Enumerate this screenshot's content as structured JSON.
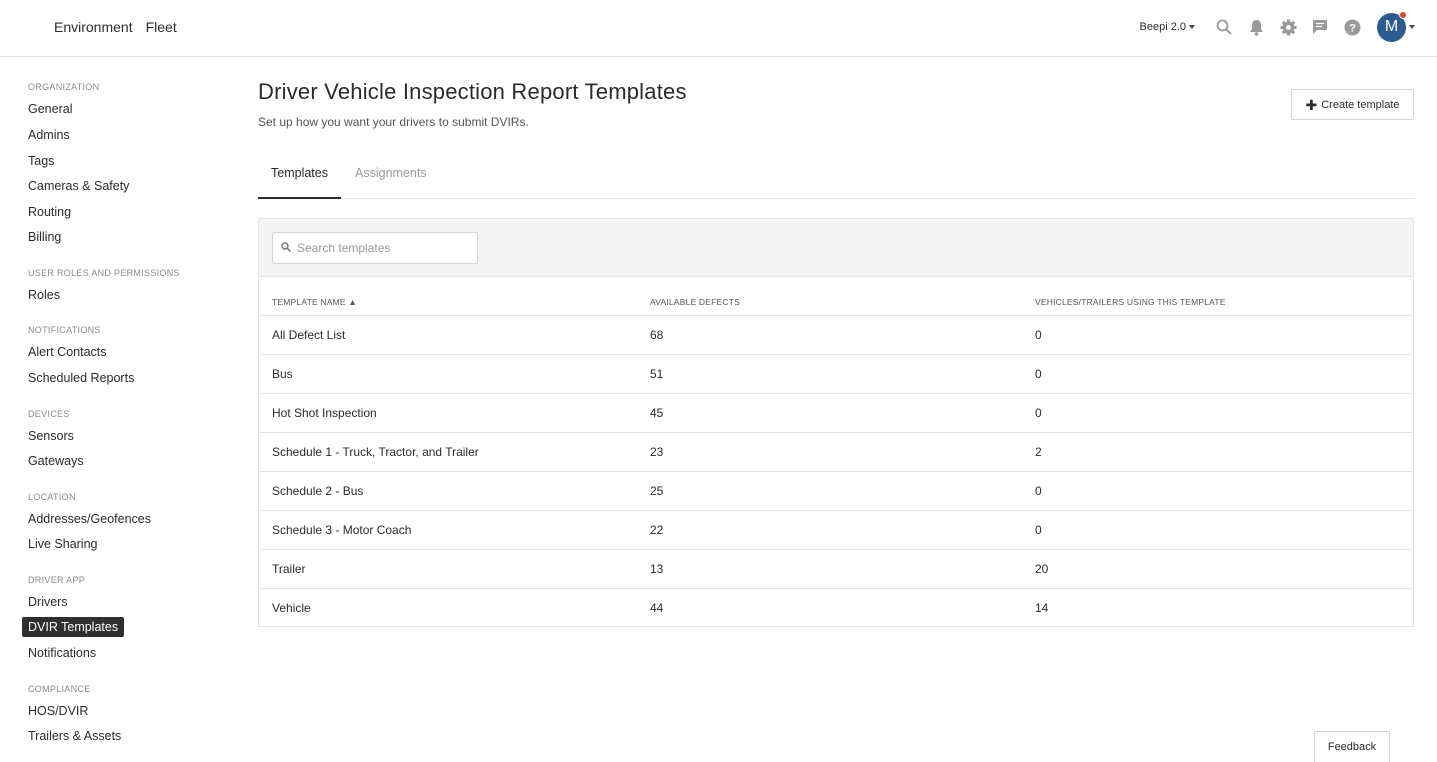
{
  "topnav": {
    "environment": "Environment",
    "fleet": "Fleet"
  },
  "header": {
    "org_name": "Beepi 2.0",
    "avatar_initial": "M"
  },
  "sidebar": {
    "sections": [
      {
        "title": "ORGANIZATION",
        "items": [
          "General",
          "Admins",
          "Tags",
          "Cameras & Safety",
          "Routing",
          "Billing"
        ]
      },
      {
        "title": "USER ROLES AND PERMISSIONS",
        "items": [
          "Roles"
        ]
      },
      {
        "title": "NOTIFICATIONS",
        "items": [
          "Alert Contacts",
          "Scheduled Reports"
        ]
      },
      {
        "title": "DEVICES",
        "items": [
          "Sensors",
          "Gateways"
        ]
      },
      {
        "title": "LOCATION",
        "items": [
          "Addresses/Geofences",
          "Live Sharing"
        ]
      },
      {
        "title": "DRIVER APP",
        "items": [
          "Drivers",
          "DVIR Templates",
          "Notifications"
        ]
      },
      {
        "title": "COMPLIANCE",
        "items": [
          "HOS/DVIR",
          "Trailers & Assets"
        ]
      }
    ]
  },
  "page": {
    "title": "Driver Vehicle Inspection Report Templates",
    "subtitle": "Set up how you want your drivers to submit DVIRs.",
    "create_label": "Create template"
  },
  "tabs": {
    "templates": "Templates",
    "assignments": "Assignments"
  },
  "search": {
    "placeholder": "Search templates"
  },
  "table": {
    "columns": [
      "TEMPLATE NAME ▲",
      "AVAILABLE DEFECTS",
      "VEHICLES/TRAILERS USING THIS TEMPLATE"
    ],
    "rows": [
      {
        "name": "All Defect List",
        "defects": "68",
        "using": "0"
      },
      {
        "name": "Bus",
        "defects": "51",
        "using": "0"
      },
      {
        "name": "Hot Shot Inspection",
        "defects": "45",
        "using": "0"
      },
      {
        "name": "Schedule 1 - Truck, Tractor, and Trailer",
        "defects": "23",
        "using": "2"
      },
      {
        "name": "Schedule 2 - Bus",
        "defects": "25",
        "using": "0"
      },
      {
        "name": "Schedule 3 - Motor Coach",
        "defects": "22",
        "using": "0"
      },
      {
        "name": "Trailer",
        "defects": "13",
        "using": "20"
      },
      {
        "name": "Vehicle",
        "defects": "44",
        "using": "14"
      }
    ]
  },
  "feedback": {
    "label": "Feedback"
  },
  "colors": {
    "avatar": "#2c5b8f",
    "notification_dot": "#e0452f",
    "active_item_bg": "#2f2f2f"
  },
  "icons": [
    "search-icon",
    "bell-icon",
    "gear-icon",
    "chat-icon",
    "help-icon",
    "plus-icon"
  ]
}
